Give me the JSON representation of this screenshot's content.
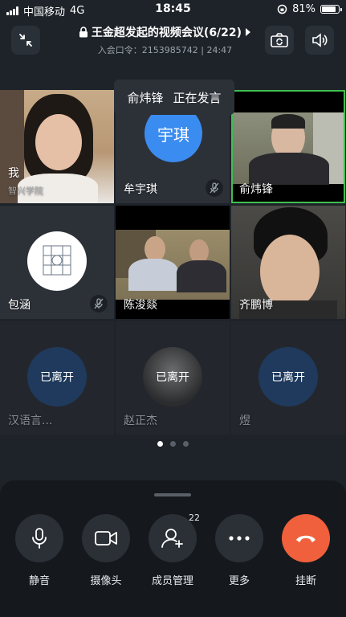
{
  "status_bar": {
    "carrier": "中国移动",
    "network": "4G",
    "time": "18:45",
    "battery": "81%"
  },
  "header": {
    "title": "王金超发起的视频会议(6/22)",
    "subtitle": "入会口令：2153985742 | 24:47"
  },
  "speaking": {
    "name": "俞炜锋",
    "status": "正在发言"
  },
  "tiles": [
    {
      "name": "我",
      "sub": "智兴学院"
    },
    {
      "name": "牟宇琪",
      "avatar_text": "宇琪"
    },
    {
      "name": "俞炜锋"
    },
    {
      "name": "包涵"
    },
    {
      "name": "陈浚燚"
    },
    {
      "name": "齐鹏博"
    },
    {
      "name": "汉语言...",
      "status": "已离开"
    },
    {
      "name": "赵正杰",
      "status": "已离开"
    },
    {
      "name": "煜",
      "status": "已离开"
    }
  ],
  "pagination": {
    "total": 3,
    "active": 1
  },
  "controls": [
    {
      "label": "静音",
      "icon": "microphone-icon"
    },
    {
      "label": "摄像头",
      "icon": "camera-icon"
    },
    {
      "label": "成员管理",
      "icon": "add-member-icon",
      "badge": "22"
    },
    {
      "label": "更多",
      "icon": "more-icon"
    },
    {
      "label": "挂断",
      "icon": "hangup-icon"
    }
  ],
  "colors": {
    "accent": "#3b8cf0",
    "hangup": "#f0603c",
    "speaking_border": "#3fbf4f",
    "left_circle": "#1f3a5c"
  }
}
